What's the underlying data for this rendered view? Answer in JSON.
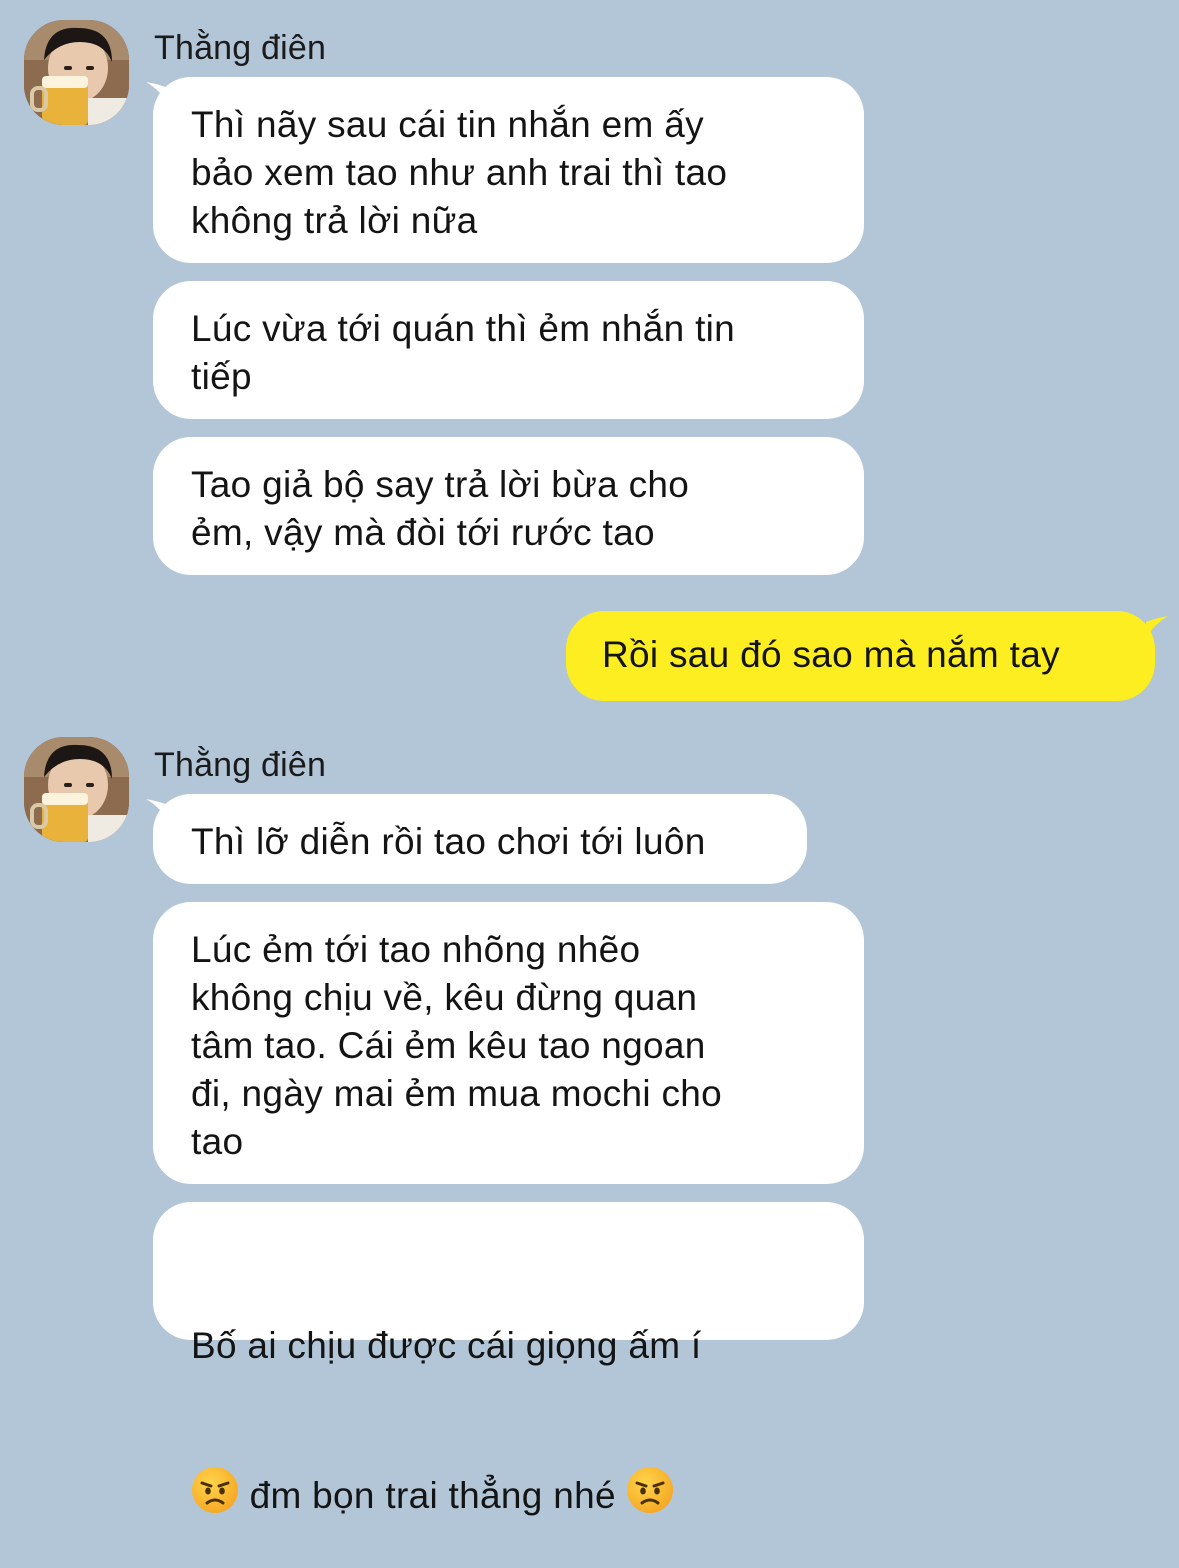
{
  "colors": {
    "background": "#b2c6d8",
    "incoming_bubble": "#ffffff",
    "outgoing_bubble": "#fcee21"
  },
  "group1": {
    "sender": "Thằng điên",
    "avatar_icon": "user-avatar-icon",
    "messages": [
      "Thì nãy sau cái tin nhắn em ấy\nbảo xem tao như anh trai thì tao\nkhông trả lời nữa",
      "Lúc vừa tới quán thì ẻm nhắn tin\ntiếp",
      "Tao giả bộ say trả lời bừa cho\nẻm, vậy mà đòi tới rước tao"
    ]
  },
  "outgoing": {
    "message": "Rồi sau đó sao mà nắm tay"
  },
  "group2": {
    "sender": "Thằng điên",
    "avatar_icon": "user-avatar-icon",
    "messages": [
      "Thì lỡ diễn rồi tao chơi tới luôn",
      "Lúc ẻm tới tao nhõng nhẽo\nkhông chịu về, kêu đừng quan\ntâm tao. Cái ẻm kêu tao ngoan\nđi, ngày mai ẻm mua mochi cho\ntao"
    ],
    "last_message": {
      "line1": "Bố ai chịu được cái giọng ấm í",
      "line2": " đm bọn trai thẳng nhé ",
      "emoji_icon": "angry-face-emoji"
    }
  }
}
